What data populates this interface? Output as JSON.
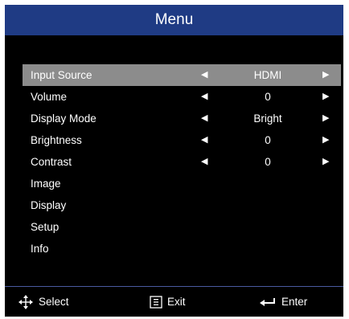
{
  "menu": {
    "title": "Menu",
    "items": [
      {
        "label": "Input Source",
        "value": "HDMI",
        "has_arrows": true,
        "selected": true
      },
      {
        "label": "Volume",
        "value": "0",
        "has_arrows": true,
        "selected": false
      },
      {
        "label": "Display Mode",
        "value": "Bright",
        "has_arrows": true,
        "selected": false
      },
      {
        "label": "Brightness",
        "value": "0",
        "has_arrows": true,
        "selected": false
      },
      {
        "label": "Contrast",
        "value": "0",
        "has_arrows": true,
        "selected": false
      },
      {
        "label": "Image",
        "value": "",
        "has_arrows": false,
        "selected": false
      },
      {
        "label": "Display",
        "value": "",
        "has_arrows": false,
        "selected": false
      },
      {
        "label": "Setup",
        "value": "",
        "has_arrows": false,
        "selected": false
      },
      {
        "label": "Info",
        "value": "",
        "has_arrows": false,
        "selected": false
      }
    ]
  },
  "footer": {
    "select_label": "Select",
    "exit_label": "Exit",
    "enter_label": "Enter",
    "select_icon": "four-way-arrows-icon",
    "exit_icon": "menu-box-icon",
    "enter_icon": "enter-return-icon"
  },
  "colors": {
    "title_bar": "#1f3b84",
    "background": "#000000",
    "selected_row": "#8c8c8c",
    "text": "#ffffff"
  }
}
